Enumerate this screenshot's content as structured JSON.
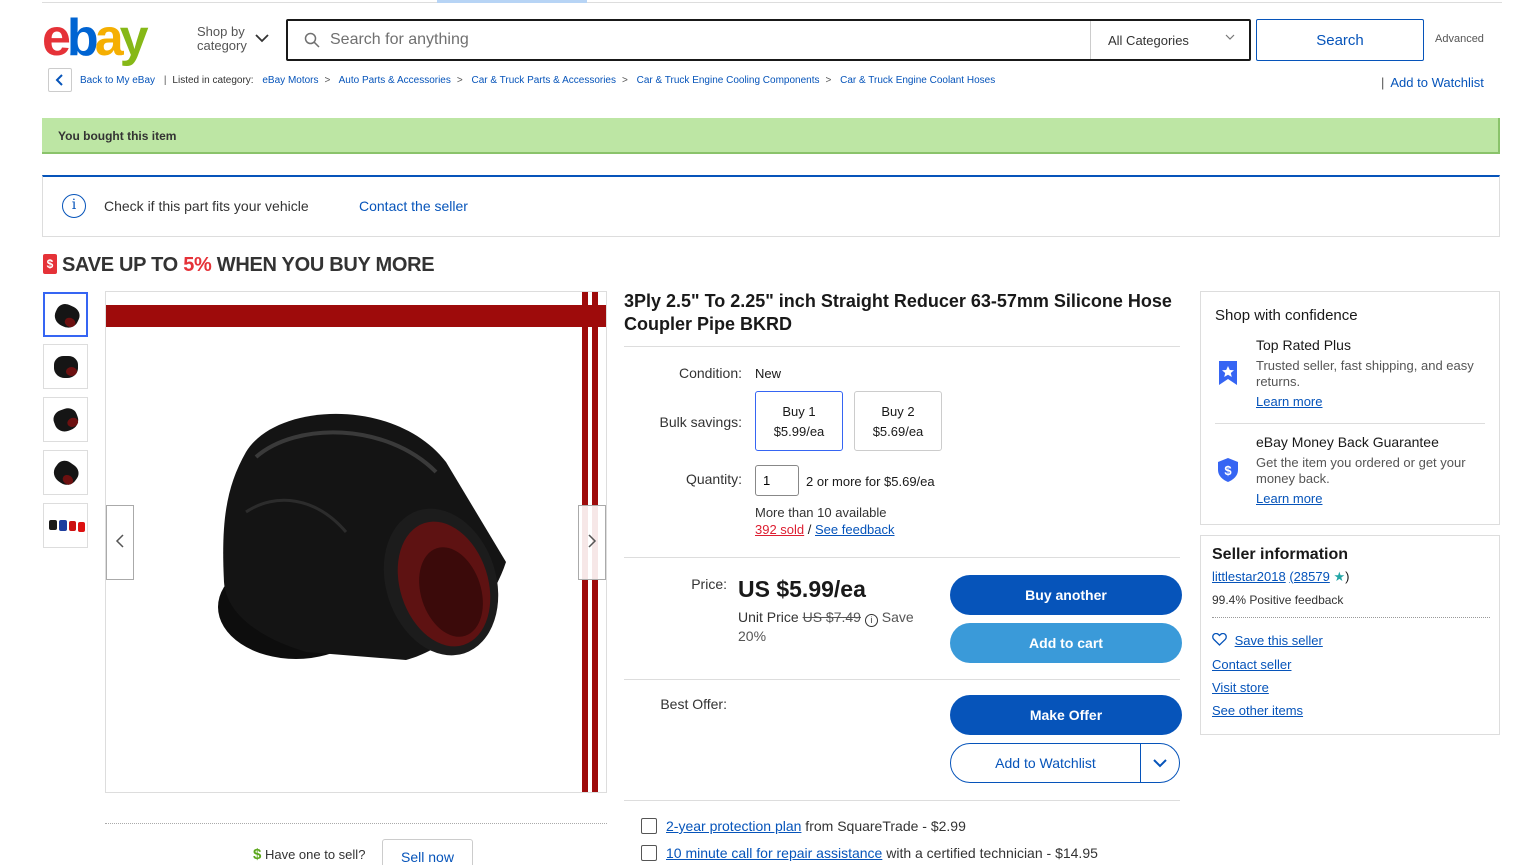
{
  "header": {
    "shop_by_line1": "Shop by",
    "shop_by_line2": "category",
    "search_placeholder": "Search for anything",
    "category_select": "All Categories",
    "search_button": "Search",
    "advanced": "Advanced"
  },
  "breadcrumb": {
    "back": "Back to My eBay",
    "listed_in": "Listed in category:",
    "items": [
      "eBay Motors",
      "Auto Parts & Accessories",
      "Car & Truck Parts & Accessories",
      "Car & Truck Engine Cooling Components",
      "Car & Truck Engine Coolant Hoses"
    ],
    "add_watchlist": "Add to Watchlist"
  },
  "banner": {
    "bought": "You bought this item"
  },
  "fits": {
    "text": "Check if this part fits your vehicle",
    "link": "Contact the seller"
  },
  "promo": {
    "prefix": "SAVE UP TO ",
    "percent": "5%",
    "suffix": " WHEN YOU BUY MORE",
    "tag_icon": "$"
  },
  "product": {
    "title": "3Ply 2.5\" To 2.25\" inch Straight Reducer 63-57mm Silicone Hose Coupler Pipe BKRD",
    "condition_label": "Condition:",
    "condition_value": "New",
    "bulk_label": "Bulk savings:",
    "bulk_options": [
      {
        "qty": "Buy 1",
        "price": "$5.99/ea"
      },
      {
        "qty": "Buy 2",
        "price": "$5.69/ea"
      }
    ],
    "quantity_label": "Quantity:",
    "quantity_value": "1",
    "quantity_note": "2 or more for $5.69/ea",
    "availability": "More than 10 available",
    "sold": "392 sold",
    "sold_sep": " / ",
    "see_feedback": "See feedback",
    "price_label": "Price:",
    "price": "US $5.99/ea",
    "unit_price_label": "Unit Price",
    "unit_price_original": "US $7.49",
    "save_word": "Save",
    "save_pct": "20%",
    "buy_another": "Buy another",
    "add_to_cart": "Add to cart",
    "best_offer_label": "Best Offer:",
    "make_offer": "Make Offer",
    "add_watchlist": "Add to Watchlist",
    "protection_link": "2-year protection plan",
    "protection_rest": " from SquareTrade - $2.99",
    "repair_link": "10 minute call for repair assistance",
    "repair_rest": " with a certified technician - $14.95"
  },
  "sell": {
    "text": "Have one to sell?",
    "button": "Sell now",
    "icon": "$"
  },
  "confidence": {
    "heading": "Shop with confidence",
    "items": [
      {
        "title": "Top Rated Plus",
        "text": "Trusted seller, fast shipping, and easy returns.",
        "link": "Learn more"
      },
      {
        "title": "eBay Money Back Guarantee",
        "text": "Get the item you ordered or get your money back.",
        "link": "Learn more"
      }
    ]
  },
  "seller": {
    "heading": "Seller information",
    "name": "littlestar2018",
    "score": "(28579",
    "score_close": ")",
    "positive": "99.4% Positive feedback",
    "save_seller": "Save this seller",
    "contact": "Contact seller",
    "visit": "Visit store",
    "other": "See other items"
  },
  "colors": {
    "accent": "#0654ba",
    "banner_green": "#bde6a4",
    "promo_red": "#e53238"
  }
}
